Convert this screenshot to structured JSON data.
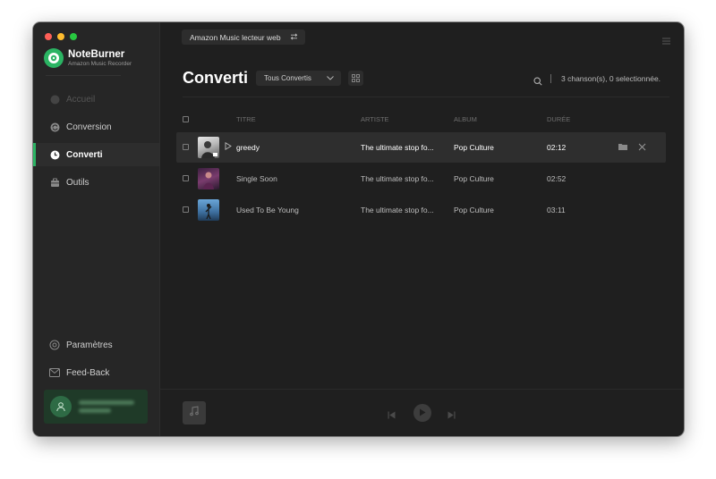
{
  "window": {
    "traffic_colors": [
      "#fe5f57",
      "#febc2e",
      "#28c840"
    ]
  },
  "brand": {
    "name": "NoteBurner",
    "subtitle": "Amazon Music Recorder",
    "accent": "#2bb463"
  },
  "sidebar": {
    "items": [
      {
        "label": "Accueil",
        "icon": "home-icon",
        "state": "disabled"
      },
      {
        "label": "Conversion",
        "icon": "refresh-icon",
        "state": "normal"
      },
      {
        "label": "Converti",
        "icon": "clock-icon",
        "state": "active"
      },
      {
        "label": "Outils",
        "icon": "toolbox-icon",
        "state": "normal"
      }
    ],
    "bottom_items": [
      {
        "label": "Paramètres",
        "icon": "settings-icon"
      },
      {
        "label": "Feed-Back",
        "icon": "mail-icon"
      }
    ]
  },
  "header": {
    "source_label": "Amazon Music lecteur web",
    "source_icon": "swap-icon",
    "menu_icon": "hamburger-menu-icon"
  },
  "page": {
    "title": "Converti",
    "filter_value": "Tous Convertis",
    "count_text": "3 chanson(s), 0 selectionnée."
  },
  "table": {
    "columns": [
      "TITRE",
      "ARTISTE",
      "ALBUM",
      "DURÉE"
    ],
    "rows": [
      {
        "title": "greedy",
        "artist": "The ultimate stop fo...",
        "album": "Pop Culture",
        "duration": "02:12",
        "selected": true
      },
      {
        "title": "Single Soon",
        "artist": "The ultimate stop fo...",
        "album": "Pop Culture",
        "duration": "02:52",
        "selected": false
      },
      {
        "title": "Used To Be Young",
        "artist": "The ultimate stop fo...",
        "album": "Pop Culture",
        "duration": "03:11",
        "selected": false
      }
    ]
  },
  "player": {
    "controls": [
      "previous-icon",
      "play-icon",
      "next-icon"
    ]
  }
}
